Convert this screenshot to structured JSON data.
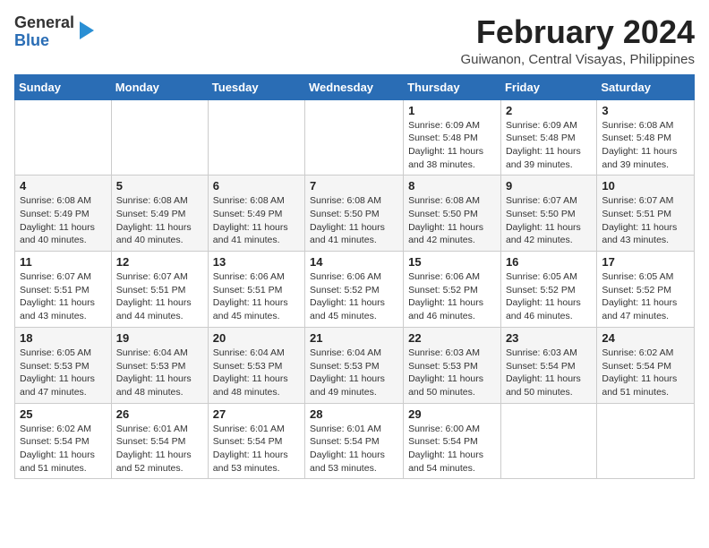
{
  "header": {
    "logo_line1": "General",
    "logo_line2": "Blue",
    "month": "February 2024",
    "location": "Guiwanon, Central Visayas, Philippines"
  },
  "columns": [
    "Sunday",
    "Monday",
    "Tuesday",
    "Wednesday",
    "Thursday",
    "Friday",
    "Saturday"
  ],
  "weeks": [
    [
      {
        "day": "",
        "info": ""
      },
      {
        "day": "",
        "info": ""
      },
      {
        "day": "",
        "info": ""
      },
      {
        "day": "",
        "info": ""
      },
      {
        "day": "1",
        "info": "Sunrise: 6:09 AM\nSunset: 5:48 PM\nDaylight: 11 hours\nand 38 minutes."
      },
      {
        "day": "2",
        "info": "Sunrise: 6:09 AM\nSunset: 5:48 PM\nDaylight: 11 hours\nand 39 minutes."
      },
      {
        "day": "3",
        "info": "Sunrise: 6:08 AM\nSunset: 5:48 PM\nDaylight: 11 hours\nand 39 minutes."
      }
    ],
    [
      {
        "day": "4",
        "info": "Sunrise: 6:08 AM\nSunset: 5:49 PM\nDaylight: 11 hours\nand 40 minutes."
      },
      {
        "day": "5",
        "info": "Sunrise: 6:08 AM\nSunset: 5:49 PM\nDaylight: 11 hours\nand 40 minutes."
      },
      {
        "day": "6",
        "info": "Sunrise: 6:08 AM\nSunset: 5:49 PM\nDaylight: 11 hours\nand 41 minutes."
      },
      {
        "day": "7",
        "info": "Sunrise: 6:08 AM\nSunset: 5:50 PM\nDaylight: 11 hours\nand 41 minutes."
      },
      {
        "day": "8",
        "info": "Sunrise: 6:08 AM\nSunset: 5:50 PM\nDaylight: 11 hours\nand 42 minutes."
      },
      {
        "day": "9",
        "info": "Sunrise: 6:07 AM\nSunset: 5:50 PM\nDaylight: 11 hours\nand 42 minutes."
      },
      {
        "day": "10",
        "info": "Sunrise: 6:07 AM\nSunset: 5:51 PM\nDaylight: 11 hours\nand 43 minutes."
      }
    ],
    [
      {
        "day": "11",
        "info": "Sunrise: 6:07 AM\nSunset: 5:51 PM\nDaylight: 11 hours\nand 43 minutes."
      },
      {
        "day": "12",
        "info": "Sunrise: 6:07 AM\nSunset: 5:51 PM\nDaylight: 11 hours\nand 44 minutes."
      },
      {
        "day": "13",
        "info": "Sunrise: 6:06 AM\nSunset: 5:51 PM\nDaylight: 11 hours\nand 45 minutes."
      },
      {
        "day": "14",
        "info": "Sunrise: 6:06 AM\nSunset: 5:52 PM\nDaylight: 11 hours\nand 45 minutes."
      },
      {
        "day": "15",
        "info": "Sunrise: 6:06 AM\nSunset: 5:52 PM\nDaylight: 11 hours\nand 46 minutes."
      },
      {
        "day": "16",
        "info": "Sunrise: 6:05 AM\nSunset: 5:52 PM\nDaylight: 11 hours\nand 46 minutes."
      },
      {
        "day": "17",
        "info": "Sunrise: 6:05 AM\nSunset: 5:52 PM\nDaylight: 11 hours\nand 47 minutes."
      }
    ],
    [
      {
        "day": "18",
        "info": "Sunrise: 6:05 AM\nSunset: 5:53 PM\nDaylight: 11 hours\nand 47 minutes."
      },
      {
        "day": "19",
        "info": "Sunrise: 6:04 AM\nSunset: 5:53 PM\nDaylight: 11 hours\nand 48 minutes."
      },
      {
        "day": "20",
        "info": "Sunrise: 6:04 AM\nSunset: 5:53 PM\nDaylight: 11 hours\nand 48 minutes."
      },
      {
        "day": "21",
        "info": "Sunrise: 6:04 AM\nSunset: 5:53 PM\nDaylight: 11 hours\nand 49 minutes."
      },
      {
        "day": "22",
        "info": "Sunrise: 6:03 AM\nSunset: 5:53 PM\nDaylight: 11 hours\nand 50 minutes."
      },
      {
        "day": "23",
        "info": "Sunrise: 6:03 AM\nSunset: 5:54 PM\nDaylight: 11 hours\nand 50 minutes."
      },
      {
        "day": "24",
        "info": "Sunrise: 6:02 AM\nSunset: 5:54 PM\nDaylight: 11 hours\nand 51 minutes."
      }
    ],
    [
      {
        "day": "25",
        "info": "Sunrise: 6:02 AM\nSunset: 5:54 PM\nDaylight: 11 hours\nand 51 minutes."
      },
      {
        "day": "26",
        "info": "Sunrise: 6:01 AM\nSunset: 5:54 PM\nDaylight: 11 hours\nand 52 minutes."
      },
      {
        "day": "27",
        "info": "Sunrise: 6:01 AM\nSunset: 5:54 PM\nDaylight: 11 hours\nand 53 minutes."
      },
      {
        "day": "28",
        "info": "Sunrise: 6:01 AM\nSunset: 5:54 PM\nDaylight: 11 hours\nand 53 minutes."
      },
      {
        "day": "29",
        "info": "Sunrise: 6:00 AM\nSunset: 5:54 PM\nDaylight: 11 hours\nand 54 minutes."
      },
      {
        "day": "",
        "info": ""
      },
      {
        "day": "",
        "info": ""
      }
    ]
  ]
}
